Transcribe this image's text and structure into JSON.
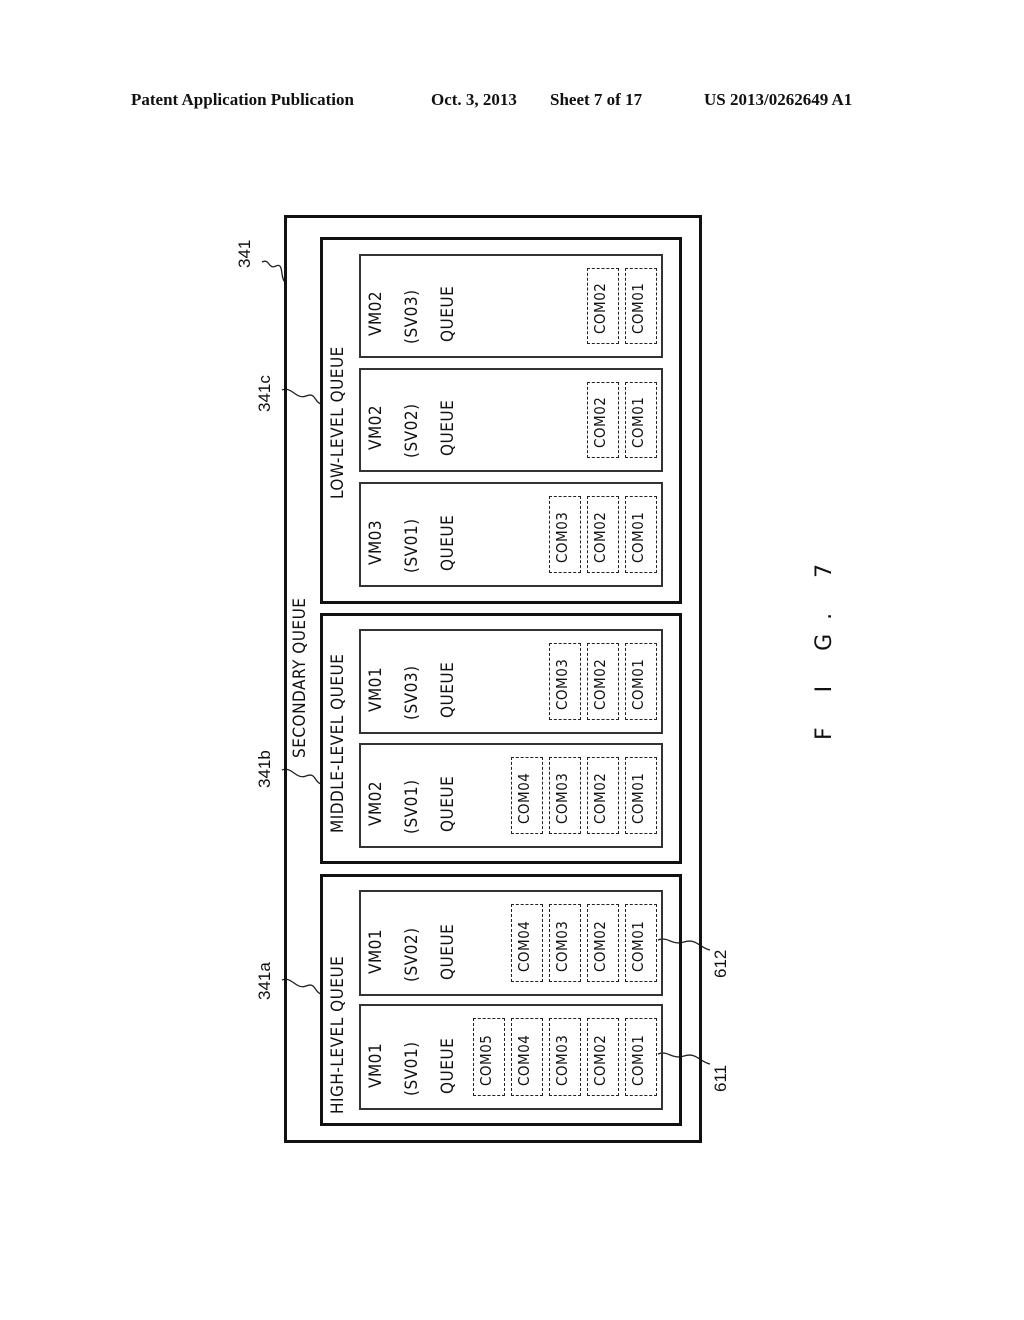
{
  "header": {
    "publication": "Patent Application Publication",
    "date": "Oct. 3, 2013",
    "sheet": "Sheet 7 of 17",
    "number": "US 2013/0262649 A1"
  },
  "figure": {
    "label": "F I G. 7",
    "container": {
      "ref": "341",
      "title": "SECONDARY QUEUE"
    },
    "levels": [
      {
        "ref": "341a",
        "title": "HIGH-LEVEL QUEUE",
        "queues": [
          {
            "vm": "VM01",
            "sv": "(SV01)",
            "queue": "QUEUE",
            "ref": "611",
            "commands": [
              "COM05",
              "COM04",
              "COM03",
              "COM02",
              "COM01"
            ]
          },
          {
            "vm": "VM01",
            "sv": "(SV02)",
            "queue": "QUEUE",
            "ref": "612",
            "commands": [
              "COM04",
              "COM03",
              "COM02",
              "COM01"
            ]
          }
        ]
      },
      {
        "ref": "341b",
        "title": "MIDDLE-LEVEL QUEUE",
        "queues": [
          {
            "vm": "VM02",
            "sv": "(SV01)",
            "queue": "QUEUE",
            "commands": [
              "COM04",
              "COM03",
              "COM02",
              "COM01"
            ]
          },
          {
            "vm": "VM01",
            "sv": "(SV03)",
            "queue": "QUEUE",
            "commands": [
              "COM03",
              "COM02",
              "COM01"
            ]
          }
        ]
      },
      {
        "ref": "341c",
        "title": "LOW-LEVEL QUEUE",
        "queues": [
          {
            "vm": "VM03",
            "sv": "(SV01)",
            "queue": "QUEUE",
            "commands": [
              "COM03",
              "COM02",
              "COM01"
            ]
          },
          {
            "vm": "VM02",
            "sv": "(SV02)",
            "queue": "QUEUE",
            "commands": [
              "COM02",
              "COM01"
            ]
          },
          {
            "vm": "VM02",
            "sv": "(SV03)",
            "queue": "QUEUE",
            "commands": [
              "COM02",
              "COM01"
            ]
          }
        ]
      }
    ]
  }
}
